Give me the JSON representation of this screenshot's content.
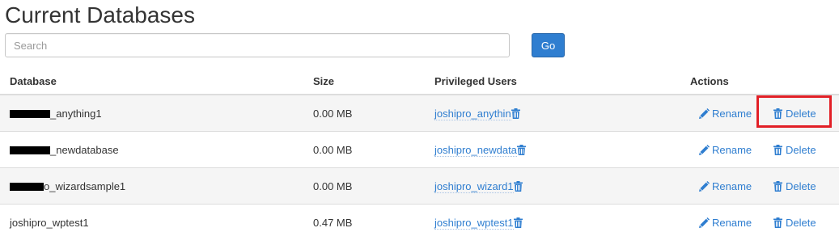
{
  "page": {
    "title": "Current Databases"
  },
  "search": {
    "placeholder": "Search",
    "value": "",
    "go_label": "Go"
  },
  "table": {
    "headers": {
      "database": "Database",
      "size": "Size",
      "users": "Privileged Users",
      "actions": "Actions"
    },
    "rows": [
      {
        "database": "_anything1",
        "size": "0.00 MB",
        "user": "joshipro_anythin",
        "rename": "Rename",
        "delete": "Delete"
      },
      {
        "database": "_newdatabase",
        "size": "0.00 MB",
        "user": "joshipro_newdata",
        "rename": "Rename",
        "delete": "Delete"
      },
      {
        "database": "o_wizardsample1",
        "size": "0.00 MB",
        "user": "joshipro_wizard1",
        "rename": "Rename",
        "delete": "Delete"
      },
      {
        "database": "joshipro_wptest1",
        "size": "0.47 MB",
        "user": "joshipro_wptest1",
        "rename": "Rename",
        "delete": "Delete"
      }
    ]
  },
  "colors": {
    "link": "#2f7ed0",
    "button": "#2f7ed0",
    "highlight": "#e21f26"
  },
  "icons": {
    "user_remove": "trash-icon",
    "rename": "pencil-icon",
    "delete": "trash-icon"
  }
}
